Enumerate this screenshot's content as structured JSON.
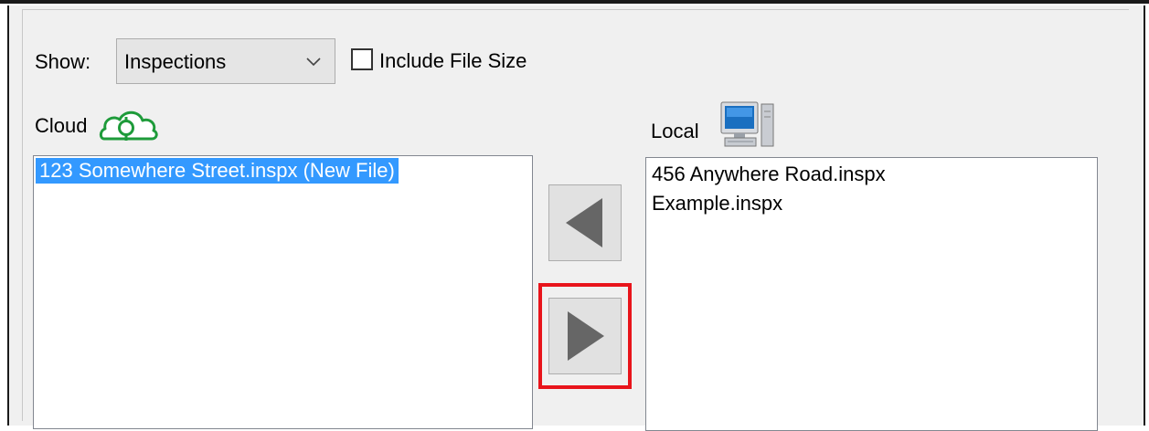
{
  "toolbar": {
    "show_label": "Show:",
    "show_select": {
      "selected": "Inspections"
    },
    "include_file_size": {
      "label": "Include File Size",
      "checked": false
    }
  },
  "cloud": {
    "label": "Cloud",
    "icon": "cloud-sync-icon",
    "files": [
      {
        "name": "123 Somewhere Street.inspx (New File)",
        "selected": true
      }
    ]
  },
  "local": {
    "label": "Local",
    "icon": "computer-icon",
    "files": [
      {
        "name": "456 Anywhere Road.inspx",
        "selected": false
      },
      {
        "name": "Example.inspx",
        "selected": false
      }
    ]
  },
  "actions": {
    "move_left": {
      "icon": "left-arrow-icon"
    },
    "move_right": {
      "icon": "right-arrow-icon",
      "highlighted": true
    }
  },
  "colors": {
    "selection": "#3399ff",
    "highlight": "#e8141b",
    "cloud_green": "#1e9b3a"
  }
}
